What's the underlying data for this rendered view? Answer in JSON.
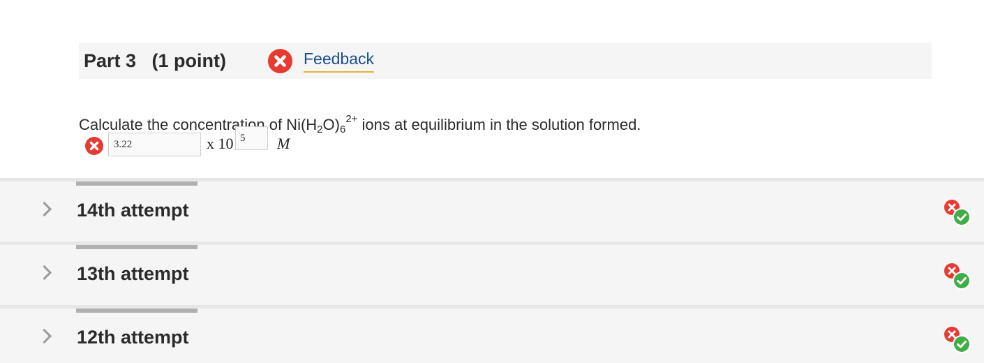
{
  "part": {
    "title": "Part 3   (1 point)",
    "status": "incorrect",
    "feedback_label": "Feedback"
  },
  "question": {
    "text_before": "Calculate the concentration of Ni(H",
    "sub1": "2",
    "text_mid": "O)",
    "sub2": "6",
    "sup": "2+",
    "text_after": " ions at equilibrium in the solution formed.",
    "mantissa_value": "3.22",
    "times_label": "x 10",
    "exponent_value": "5",
    "unit": "M"
  },
  "attempts": [
    {
      "label": "14th attempt",
      "status_icons": [
        "incorrect-icon",
        "correct-icon"
      ]
    },
    {
      "label": "13th attempt",
      "status_icons": [
        "incorrect-icon",
        "correct-icon"
      ]
    },
    {
      "label": "12th attempt",
      "status_icons": [
        "incorrect-icon",
        "correct-icon"
      ]
    }
  ],
  "colors": {
    "incorrect": "#e53b32",
    "correct": "#3fae49",
    "link": "#1b4d8c",
    "link_underline": "#e3b33c"
  }
}
